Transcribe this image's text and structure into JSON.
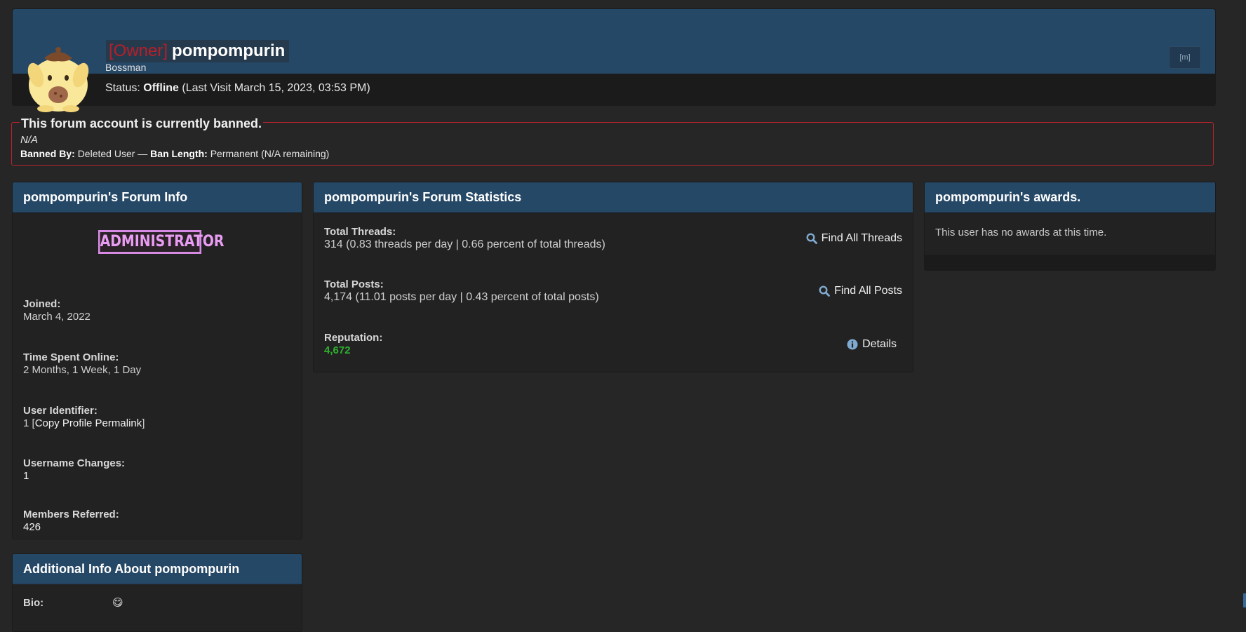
{
  "profile": {
    "owner_tag": "[Owner]",
    "username": "pompompurin",
    "user_title": "Bossman",
    "status_label": "Status:",
    "status_value": "Offline",
    "last_visit": "(Last Visit March 15, 2023, 03:53 PM)",
    "mini_button": "[m]"
  },
  "ban": {
    "title": "This forum account is currently banned.",
    "reason": "N/A",
    "banned_by_label": "Banned By:",
    "banned_by": "Deleted User",
    "separator": "—",
    "ban_length_label": "Ban Length:",
    "ban_length": "Permanent (N/A remaining)"
  },
  "forum_info": {
    "title": "pompompurin's Forum Info",
    "badge": "ADMINISTRATOR",
    "joined_label": "Joined:",
    "joined": "March 4, 2022",
    "time_online_label": "Time Spent Online:",
    "time_online": "2 Months, 1 Week, 1 Day",
    "uid_label": "User Identifier:",
    "uid": "1",
    "uid_bracket_open": "[",
    "copy_permalink": "Copy Profile Permalink",
    "uid_bracket_close": "]",
    "username_changes_label": "Username Changes:",
    "username_changes": "1",
    "members_referred_label": "Members Referred:",
    "members_referred": "426"
  },
  "additional_info": {
    "title": "Additional Info About pompompurin",
    "bio_label": "Bio:",
    "bio": "😋"
  },
  "statistics": {
    "title": "pompompurin's Forum Statistics",
    "threads_label": "Total Threads:",
    "threads": "314 (0.83 threads per day | 0.66 percent of total threads)",
    "find_threads": "Find All Threads",
    "posts_label": "Total Posts:",
    "posts": "4,174 (11.01 posts per day | 0.43 percent of total posts)",
    "find_posts": "Find All Posts",
    "reputation_label": "Reputation:",
    "reputation": "4,672",
    "details": "Details"
  },
  "awards": {
    "title": "pompompurin's awards.",
    "empty_text": "This user has no awards at this time."
  },
  "colors": {
    "header_blue": "#264867",
    "ban_red": "#b8232d",
    "owner_red": "#b51f2a",
    "reputation_green": "#2fb12f",
    "admin_pink": "#e99df2"
  }
}
